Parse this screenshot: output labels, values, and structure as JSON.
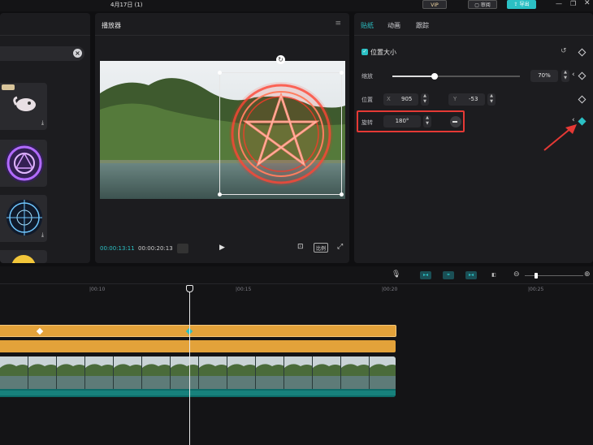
{
  "titlebar": {
    "title": "4月17日 (1)",
    "vip_label": "VIP",
    "review_label": "审阅",
    "export_label": "导出"
  },
  "left_panel": {},
  "player": {
    "title": "播放器",
    "time_current": "00:00:13:11",
    "time_total": "00:00:20:13",
    "ratio_label": "比例"
  },
  "props": {
    "tabs": [
      {
        "label": "贴纸",
        "active": true
      },
      {
        "label": "动画",
        "active": false
      },
      {
        "label": "跟踪",
        "active": false
      }
    ],
    "section_title": "位置大小",
    "scale": {
      "label": "缩放",
      "value": "70%",
      "level": 0.33
    },
    "position": {
      "label": "位置",
      "x_label": "X",
      "x_value": "905",
      "y_label": "Y",
      "y_value": "-53"
    },
    "rotate": {
      "label": "旋转",
      "value": "180°"
    }
  },
  "timeline": {
    "ruler": [
      "|00:10",
      "|00:15",
      "|00:20",
      "|00:25"
    ]
  },
  "colors": {
    "accent": "#2bc0c4",
    "annotation_red": "#e53935",
    "clip_orange": "#e3a23a",
    "clip_video": "#0d6b68"
  }
}
